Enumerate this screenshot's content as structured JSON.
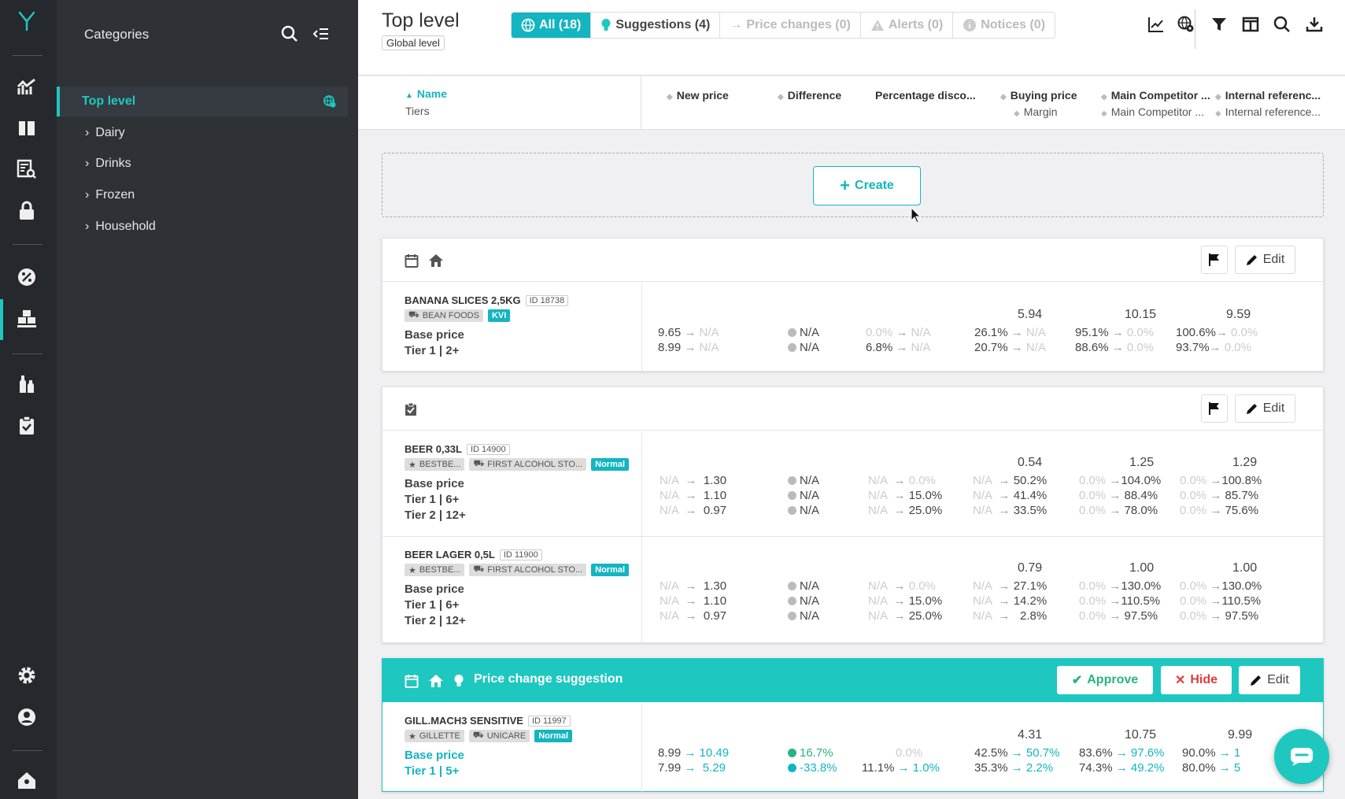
{
  "sidebar": {
    "header": "Categories",
    "selected": "Top level",
    "categories": [
      "Dairy",
      "Drinks",
      "Frozen",
      "Household"
    ]
  },
  "topbar": {
    "title": "Top level",
    "subtitle": "Global level",
    "tabs": [
      {
        "label": "All (18)"
      },
      {
        "label": "Suggestions (4)"
      },
      {
        "label": "Price changes (0)"
      },
      {
        "label": "Alerts (0)"
      },
      {
        "label": "Notices (0)"
      }
    ]
  },
  "columns": {
    "name": "Name",
    "tiers": "Tiers",
    "new_price": "New price",
    "difference": "Difference",
    "percentage_discount": "Percentage disco...",
    "buying_price": "Buying price",
    "margin": "Margin",
    "main_competitor_1": "Main Competitor ...",
    "main_competitor_2": "Main Competitor ...",
    "internal_reference_1": "Internal referenc...",
    "internal_reference_2": "Internal reference..."
  },
  "create_label": "Create",
  "buttons": {
    "edit": "Edit",
    "approve": "Approve",
    "hide": "Hide"
  },
  "na": "N/A",
  "products": {
    "banana": {
      "name": "BANANA SLICES 2,5KG",
      "id": "ID 18738",
      "supplier": "BEAN FOODS",
      "badge": "KVI",
      "tiers": [
        "Base price",
        "Tier 1 | 2+"
      ],
      "buy": "5.94",
      "comp": "10.15",
      "ref": "9.59",
      "price": [
        "9.65",
        "8.99"
      ],
      "pct": [
        "0.0%",
        "6.8%"
      ],
      "margin": [
        "26.1%",
        "20.7%"
      ],
      "comp_pct": [
        "95.1%",
        "88.6%"
      ],
      "comp_new": "0.0%",
      "ref_pct": [
        "100.6%",
        "93.7%"
      ],
      "ref_new": "0.0%"
    },
    "beer": {
      "name": "BEER 0,33L",
      "id": "ID 14900",
      "brand": "BESTBE...",
      "supplier": "FIRST ALCOHOL STO...",
      "badge": "Normal",
      "tiers": [
        "Base price",
        "Tier 1 | 6+",
        "Tier 2 | 12+"
      ],
      "buy": "0.54",
      "comp": "1.25",
      "ref": "1.29",
      "new": [
        "1.30",
        "1.10",
        "0.97"
      ],
      "pct": [
        "0.0%",
        "15.0%",
        "25.0%"
      ],
      "margin": [
        "50.2%",
        "41.4%",
        "33.5%"
      ],
      "comp_old": "0.0%",
      "comp_pct": [
        "104.0%",
        "88.4%",
        "78.0%"
      ],
      "ref_old": "0.0%",
      "ref_pct": [
        "100.8%",
        "85.7%",
        "75.6%"
      ]
    },
    "lager": {
      "name": "BEER LAGER 0,5L",
      "id": "ID 11900",
      "brand": "BESTBE...",
      "supplier": "FIRST ALCOHOL STO...",
      "badge": "Normal",
      "tiers": [
        "Base price",
        "Tier 1 | 6+",
        "Tier 2 | 12+"
      ],
      "buy": "0.79",
      "comp": "1.00",
      "ref": "1.00",
      "new": [
        "1.30",
        "1.10",
        "0.97"
      ],
      "pct": [
        "0.0%",
        "15.0%",
        "25.0%"
      ],
      "margin": [
        "27.1%",
        "14.2%",
        "2.8%"
      ],
      "comp_old": "0.0%",
      "comp_pct": [
        "130.0%",
        "110.5%",
        "97.5%"
      ],
      "ref_old": "0.0%",
      "ref_pct": [
        "130.0%",
        "110.5%",
        "97.5%"
      ]
    },
    "gill": {
      "name": "GILL.MACH3 SENSITIVE",
      "id": "ID 11997",
      "brand": "GILLETTE",
      "supplier": "UNICARE",
      "badge": "Normal",
      "tiers": [
        "Base price",
        "Tier 1 | 5+"
      ],
      "buy": "4.31",
      "comp": "10.75",
      "ref": "9.99",
      "old": [
        "8.99",
        "7.99"
      ],
      "new": [
        "10.49",
        "5.29"
      ],
      "diff": [
        "16.7%",
        "-33.8%"
      ],
      "pct_head": "0.0%",
      "pct_old": "11.1%",
      "pct_new": "1.0%",
      "margin_old": [
        "42.5%",
        "35.3%"
      ],
      "margin_new": [
        "50.7%",
        "2.2%"
      ],
      "comp_old": [
        "83.6%",
        "74.3%"
      ],
      "comp_new": [
        "97.6%",
        "49.2%"
      ],
      "ref_old": [
        "90.0%",
        "80.0%"
      ],
      "ref_new": [
        "1",
        "5"
      ]
    }
  },
  "suggestion_title": "Price change suggestion",
  "colors": {
    "accent": "#13b5c0",
    "suggestion": "#1ec8c0",
    "rail": "#25282c",
    "sidebar": "#2e3236"
  }
}
